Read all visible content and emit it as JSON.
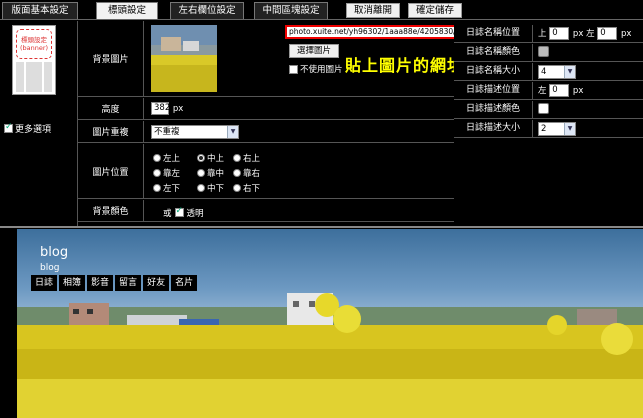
{
  "tabs": [
    {
      "label": "版面基本設定",
      "active": false
    },
    {
      "label": "標頭設定",
      "active": true
    },
    {
      "label": "左右欄位設定",
      "active": false
    },
    {
      "label": "中間區塊設定",
      "active": false
    }
  ],
  "actions": {
    "cancel_label": "取消離開",
    "save_label": "確定儲存"
  },
  "left": {
    "thumb_title": "標頭設定",
    "thumb_sub": "(banner)",
    "more_options_label": "更多選項",
    "more_options_checked": true
  },
  "form": {
    "bg_image": {
      "label": "背景圖片",
      "url": "photo.xuite.net/yh96302/1aaa88e/4205830/161132680_x.jpg",
      "choose_label": "選擇圖片",
      "no_image_label": "不使用圖片",
      "annotation": "貼上圖片的網址"
    },
    "height": {
      "label": "高度",
      "value": "382",
      "unit": "px"
    },
    "repeat": {
      "label": "圖片重複",
      "value": "不重複"
    },
    "position": {
      "label": "圖片位置",
      "options": [
        "左上",
        "中上",
        "右上",
        "靠左",
        "靠中",
        "靠右",
        "左下",
        "中下",
        "右下"
      ],
      "selected": "中上"
    },
    "bg_color": {
      "label": "背景顏色",
      "or_label": "或",
      "transparent_label": "透明",
      "transparent_checked": true
    }
  },
  "right": {
    "title_pos": {
      "label": "日誌名稱位置",
      "top_label": "上",
      "top_value": "0",
      "top_unit": "px",
      "left_label": "左",
      "left_value": "0",
      "left_unit": "px"
    },
    "title_color": {
      "label": "日誌名稱顏色",
      "color": "#bbbbbb"
    },
    "title_size": {
      "label": "日誌名稱大小",
      "value": "4"
    },
    "desc_pos": {
      "label": "日誌描述位置",
      "left_label": "左",
      "left_value": "0",
      "unit": "px"
    },
    "desc_color": {
      "label": "日誌描述顏色",
      "color": "#ffffff"
    },
    "desc_size": {
      "label": "日誌描述大小",
      "value": "2"
    }
  },
  "preview": {
    "title": "blog",
    "subtitle": "blog",
    "nav": [
      "日誌",
      "相簿",
      "影音",
      "留言",
      "好友",
      "名片"
    ]
  }
}
